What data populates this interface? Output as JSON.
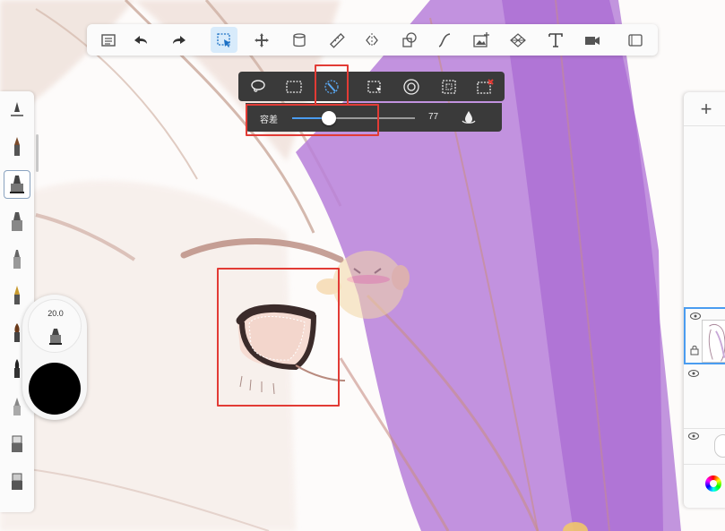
{
  "toolbar": {
    "tools": [
      "list-icon",
      "undo-icon",
      "redo-icon",
      "select-icon",
      "move-icon",
      "fill-icon",
      "ruler-icon",
      "symmetry-icon",
      "shape-icon",
      "curve-icon",
      "image-import-icon",
      "perspective-icon",
      "text-icon",
      "video-icon",
      "fullscreen-icon"
    ],
    "active_tool": "select-icon"
  },
  "selection_toolbar": {
    "tools": [
      "lasso-icon",
      "rect-select-icon",
      "magic-wand-icon",
      "transform-selection-icon",
      "target-icon",
      "select-all-icon",
      "clear-selection-icon"
    ],
    "active_tool": "magic-wand-icon"
  },
  "tolerance": {
    "label": "容差",
    "value": "77",
    "fraction": 0.3
  },
  "brush_puck": {
    "size": "20.0",
    "color": "#000000"
  },
  "brushes": {
    "count": 11,
    "active_index": 1
  },
  "colors": {
    "accent": "#4a9cf0",
    "highlight": "#e23b35",
    "hair_purple": "#b77fd9",
    "panel_dark": "#3a3a3a"
  },
  "layers": {
    "add_label": "+"
  }
}
